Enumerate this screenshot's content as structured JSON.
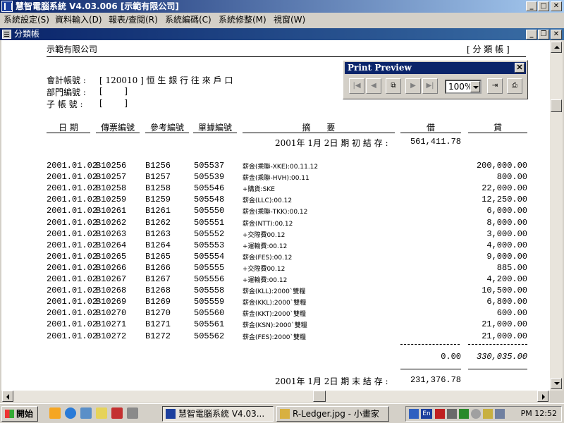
{
  "window": {
    "title": "慧智電腦系統 V4.03.006 [示範有限公司]"
  },
  "menu": [
    "系統設定(S)",
    "資料輸入(D)",
    "報表/查閱(R)",
    "系統編碼(C)",
    "系統修整(M)",
    "視窗(W)"
  ],
  "child_window": {
    "title": "分類帳"
  },
  "report": {
    "company": "示範有限公司",
    "report_name": "[ 分 類 帳 ]",
    "account_label": "會計帳號 :",
    "account_value": "[ 120010 ] 恒 生 銀 行 往 來 戶 口",
    "dept_label": "部門編號 :",
    "dept_value": "[        ]",
    "sub_label": "子 帳 號 :",
    "sub_value": "[        ]",
    "columns": [
      "日 期",
      "傳票編號",
      "參考編號",
      "單據編號",
      "摘      要",
      "借",
      "貸"
    ],
    "opening_label": "2001年 1月 2日 期 初 結 存 :",
    "opening_value": "561,411.78",
    "rows": [
      {
        "date": "2001.01.02",
        "voucher": "B10256",
        "ref": "B1256",
        "doc": "505537",
        "desc": "薪金(乘聯-XKE):00.11.12",
        "debit": "",
        "credit": "200,000.00"
      },
      {
        "date": "2001.01.02",
        "voucher": "B10257",
        "ref": "B1257",
        "doc": "505539",
        "desc": "薪金(乘聯-HVH):00.11",
        "debit": "",
        "credit": "800.00"
      },
      {
        "date": "2001.01.02",
        "voucher": "B10258",
        "ref": "B1258",
        "doc": "505546",
        "desc": "+購貨:SKE",
        "debit": "",
        "credit": "22,000.00"
      },
      {
        "date": "2001.01.02",
        "voucher": "B10259",
        "ref": "B1259",
        "doc": "505548",
        "desc": "薪金(LLC):00.12",
        "debit": "",
        "credit": "12,250.00"
      },
      {
        "date": "2001.01.02",
        "voucher": "B10261",
        "ref": "B1261",
        "doc": "505550",
        "desc": "薪金(乘聯-TKK):00.12",
        "debit": "",
        "credit": "6,000.00"
      },
      {
        "date": "2001.01.02",
        "voucher": "B10262",
        "ref": "B1262",
        "doc": "505551",
        "desc": "薪金(NTT):00.12",
        "debit": "",
        "credit": "8,000.00"
      },
      {
        "date": "2001.01.02",
        "voucher": "B10263",
        "ref": "B1263",
        "doc": "505552",
        "desc": "+交際費00.12",
        "debit": "",
        "credit": "3,000.00"
      },
      {
        "date": "2001.01.02",
        "voucher": "B10264",
        "ref": "B1264",
        "doc": "505553",
        "desc": "+運輸費:00.12",
        "debit": "",
        "credit": "4,000.00"
      },
      {
        "date": "2001.01.02",
        "voucher": "B10265",
        "ref": "B1265",
        "doc": "505554",
        "desc": "薪金(FES):00.12",
        "debit": "",
        "credit": "9,000.00"
      },
      {
        "date": "2001.01.02",
        "voucher": "B10266",
        "ref": "B1266",
        "doc": "505555",
        "desc": "+交際費00.12",
        "debit": "",
        "credit": "885.00"
      },
      {
        "date": "2001.01.02",
        "voucher": "B10267",
        "ref": "B1267",
        "doc": "505556",
        "desc": "+運輸費:00.12",
        "debit": "",
        "credit": "4,200.00"
      },
      {
        "date": "2001.01.02",
        "voucher": "B10268",
        "ref": "B1268",
        "doc": "505558",
        "desc": "薪金(KLL):2000`雙糧",
        "debit": "",
        "credit": "10,500.00"
      },
      {
        "date": "2001.01.02",
        "voucher": "B10269",
        "ref": "B1269",
        "doc": "505559",
        "desc": "薪金(KKL):2000`雙糧",
        "debit": "",
        "credit": "6,800.00"
      },
      {
        "date": "2001.01.02",
        "voucher": "B10270",
        "ref": "B1270",
        "doc": "505560",
        "desc": "薪金(KKT):2000`雙糧",
        "debit": "",
        "credit": "600.00"
      },
      {
        "date": "2001.01.02",
        "voucher": "B10271",
        "ref": "B1271",
        "doc": "505561",
        "desc": "薪金(KSN):2000`雙糧",
        "debit": "",
        "credit": "21,000.00"
      },
      {
        "date": "2001.01.02",
        "voucher": "B10272",
        "ref": "B1272",
        "doc": "505562",
        "desc": "薪金(FES):2000`雙糧",
        "debit": "",
        "credit": "21,000.00"
      }
    ],
    "total_debit": "0.00",
    "total_credit": "330,035.00",
    "closing_label": "2001年 1月 2日 期 末 結 存 :",
    "closing_value": "231,376.78"
  },
  "print_preview": {
    "title": "Print Preview",
    "zoom": "100%",
    "buttons": [
      "first-page-icon",
      "prev-page-icon",
      "copy-icon",
      "next-page-icon",
      "last-page-icon",
      "exit-icon",
      "printer-icon"
    ]
  },
  "taskbar": {
    "start_label": "開始",
    "tasks": [
      "慧智電腦系統 V4.03...",
      "R-Ledger.jpg - 小畫家"
    ],
    "clock": "PM 12:52",
    "ime": "En"
  }
}
